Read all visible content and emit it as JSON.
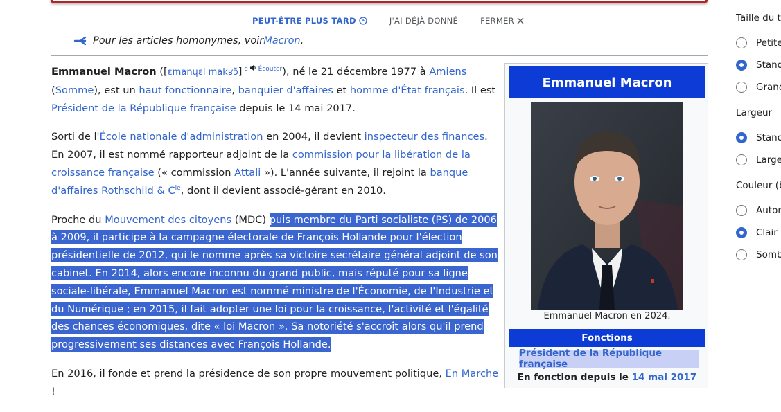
{
  "banner": {
    "later_label": "PEUT-ÊTRE PLUS TARD",
    "donated_label": "J'AI DÉJÀ DONNÉ",
    "close_label": "FERMER"
  },
  "hatnote": {
    "text": "Pour les articles homonymes, voir ",
    "link": "Macron",
    "end": "."
  },
  "article": {
    "p1": {
      "name": "Emmanuel Macron",
      "ipa_open": " ([",
      "ipa": "ɛmanɥɛl makʁɔ̃",
      "ipa_close": "]",
      "sup": "e",
      "listen": "Écouter",
      "t1": "), né le 21 décembre 1977 à ",
      "amiens": "Amiens",
      "t2": " (",
      "somme": "Somme",
      "t3": "), est un ",
      "haut": "haut fonctionnaire",
      "c1": ", ",
      "banquier": "banquier d'affaires",
      "t4": " et ",
      "homme": "homme d'État français",
      "t5": ". Il est ",
      "president": "Président de la République française",
      "t6": " depuis le 14 mai 2017."
    },
    "p2": {
      "t1": "Sorti de l'",
      "ena": "École nationale d'administration",
      "t2": " en 2004, il devient ",
      "insp": "inspecteur des finances",
      "t3": ". En 2007, il est nommé rapporteur adjoint de la ",
      "comm": "commission pour la libération de la croissance française",
      "t4": " (« commission ",
      "attali": "Attali",
      "t5": " »). L'année suivante, il rejoint la ",
      "banque": "banque d'affaires Rothschild & C",
      "banque_sup": "ie",
      "t6": ", dont il devient associé-gérant en 2010."
    },
    "p3": {
      "t1": "Proche du ",
      "mdc": "Mouvement des citoyens",
      "t2": " (MDC) ",
      "selected": "puis membre du Parti socialiste (PS) de 2006 à 2009, il participe à la campagne électorale de François Hollande pour l'élection présidentielle de 2012, qui le nomme après sa victoire secrétaire général adjoint de son cabinet. En 2014, alors encore inconnu du grand public, mais réputé pour sa ligne sociale-libérale, Emmanuel Macron est nommé ministre de l'Économie, de l'Industrie et du Numérique ; en 2015, il fait adopter une loi pour la croissance, l'activité et l'égalité des chances économiques, dite « loi Macron ». Sa notoriété s'accroît alors qu'il prend progressivement ses distances avec François Hollande."
    },
    "p4": {
      "t1": "En 2016, il fonde et prend la présidence de son propre mouvement politique, ",
      "em": "En Marche",
      "t2": " !"
    }
  },
  "infobox": {
    "title": "Emmanuel Macron",
    "caption": "Emmanuel Macron en 2024.",
    "section": "Fonctions",
    "role": "Président de la République française",
    "since_label": "En fonction depuis le ",
    "since_date": "14 mai 2017"
  },
  "right_panel": {
    "text_size_heading": "Taille du te",
    "text_size_options": [
      {
        "label": "Petite",
        "checked": false
      },
      {
        "label": "Stand",
        "checked": true
      },
      {
        "label": "Grand",
        "checked": false
      }
    ],
    "width_heading": "Largeur",
    "width_options": [
      {
        "label": "Stand",
        "checked": true
      },
      {
        "label": "Large",
        "checked": false
      }
    ],
    "color_heading": "Couleur (b",
    "color_options": [
      {
        "label": "Autom",
        "checked": false
      },
      {
        "label": "Clair",
        "checked": true
      },
      {
        "label": "Somb",
        "checked": false
      }
    ]
  },
  "colors": {
    "accent": "#3366cc",
    "infobox_header": "#0d3bd5",
    "selection": "#3b66cf",
    "banner_border": "#b32424"
  }
}
